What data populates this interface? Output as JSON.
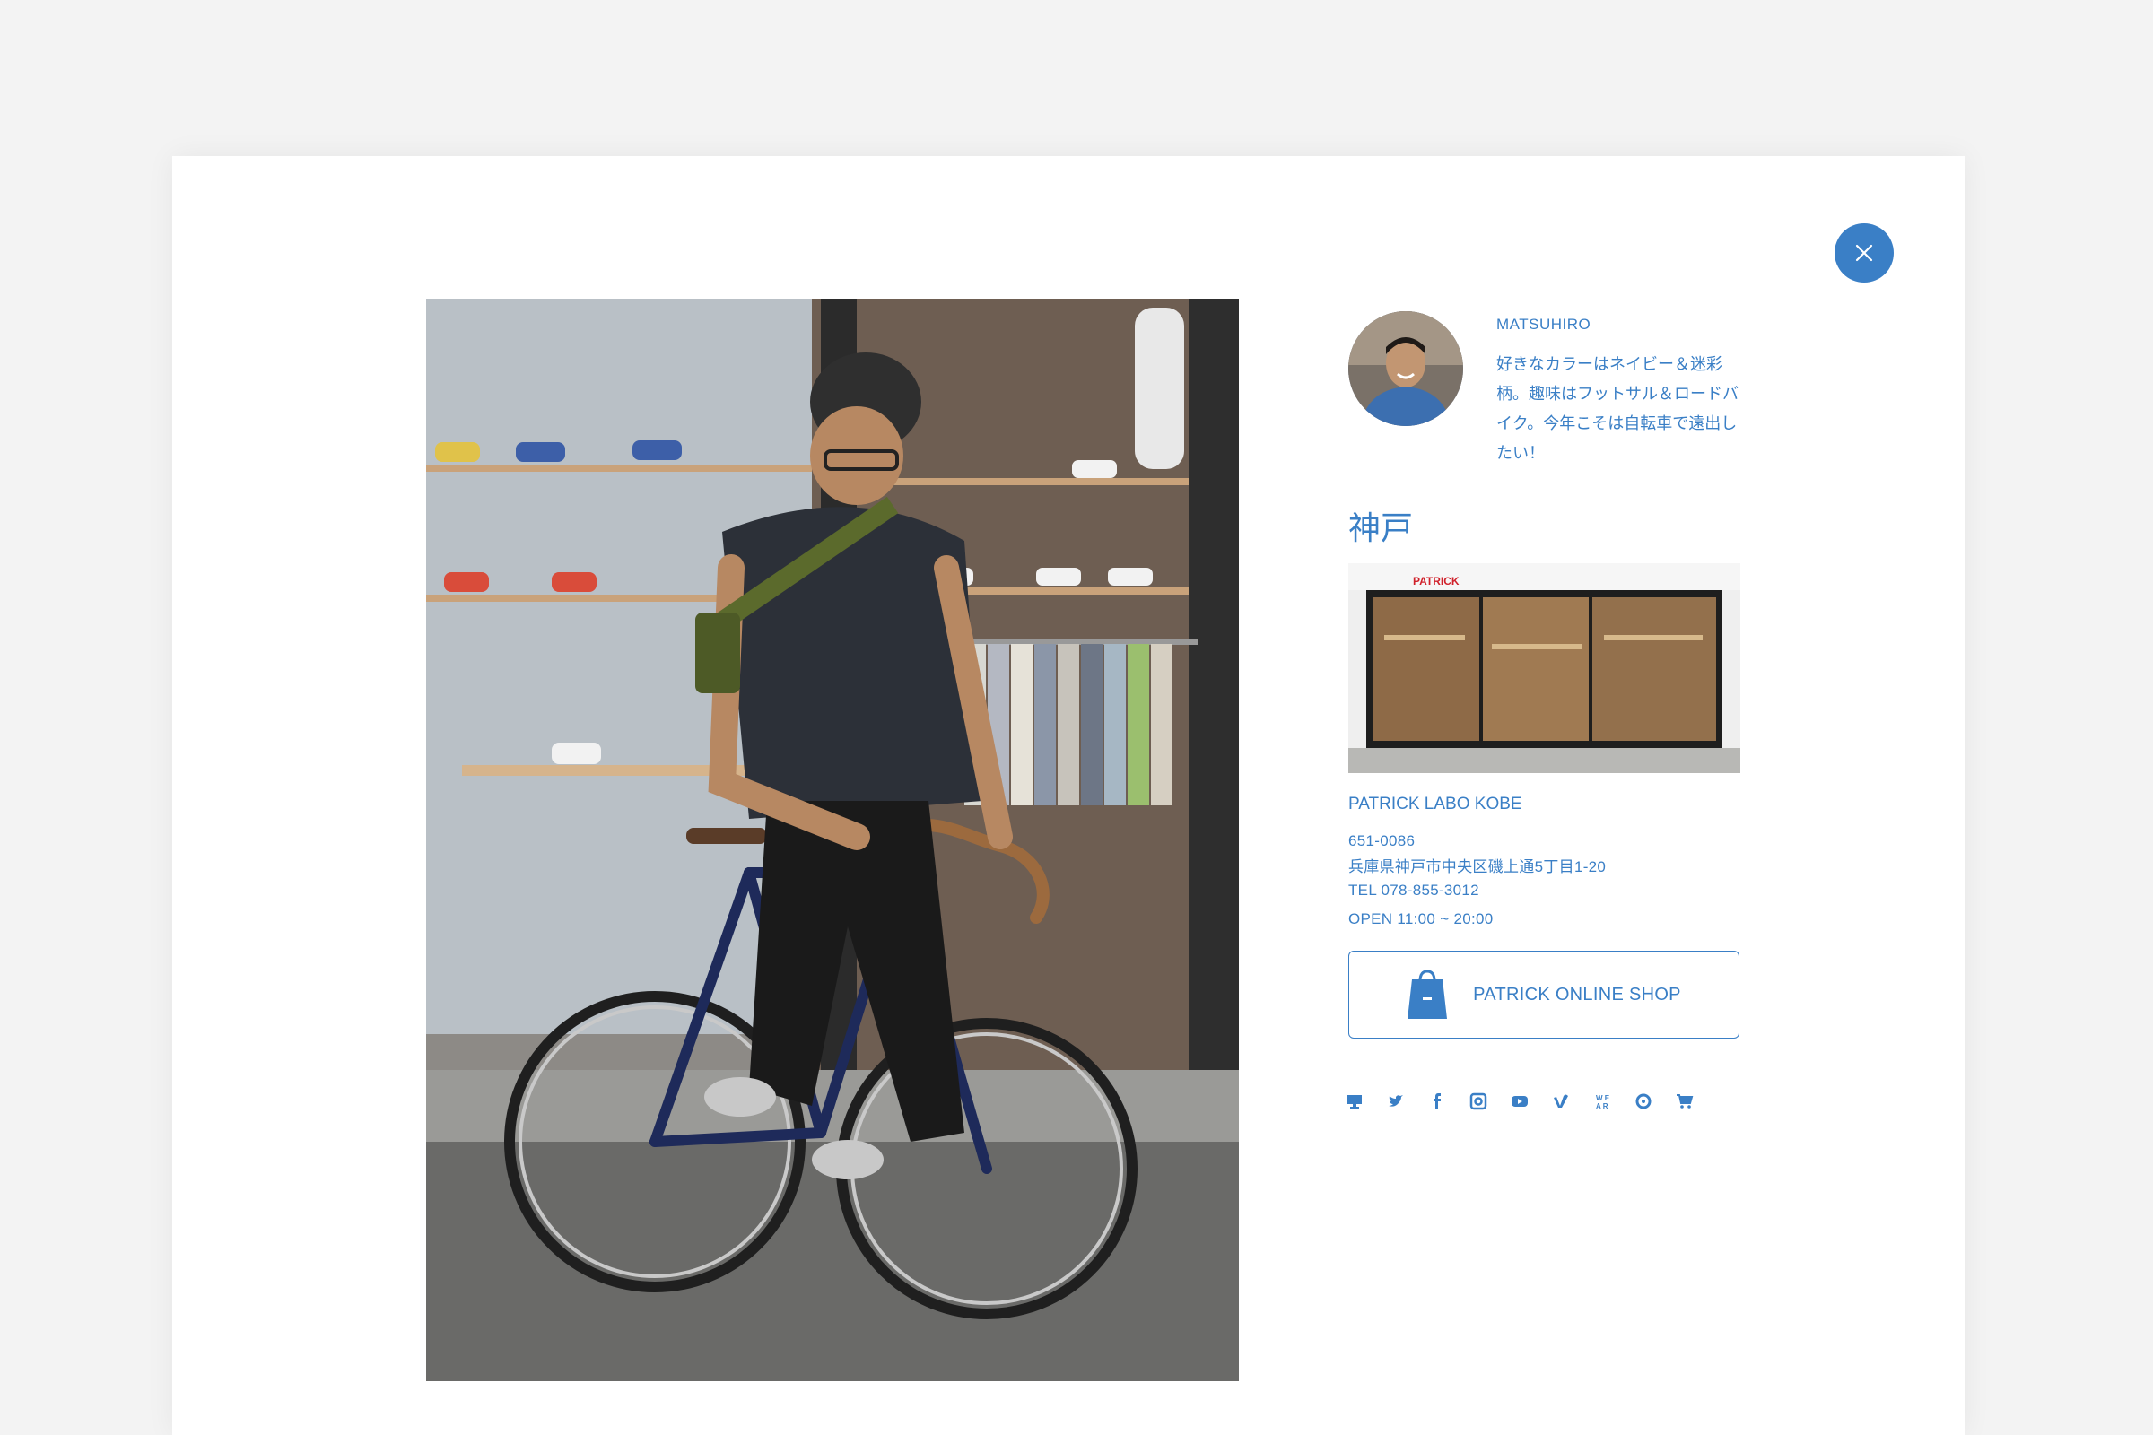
{
  "colors": {
    "accent": "#3a7fc6",
    "background": "#f3f3f3",
    "panel": "#ffffff"
  },
  "staff": {
    "name": "MATSUHIRO",
    "bio": "好きなカラーはネイビー＆迷彩柄。趣味はフットサル＆ロードバイク。今年こそは自転車で遠出したい！"
  },
  "store": {
    "city": "神戸",
    "name": "PATRICK LABO KOBE",
    "postal": "651-0086",
    "address": "兵庫県神戸市中央区磯上通5丁目1-20",
    "tel": "TEL 078-855-3012",
    "hours": "OPEN 11:00 ~ 20:00",
    "sign": "PATRICK"
  },
  "shop_button": {
    "label": "PATRICK ONLINE SHOP",
    "icon": "shopping-bag-icon"
  },
  "social_icons": [
    "website-icon",
    "twitter-icon",
    "facebook-icon",
    "instagram-icon",
    "youtube-icon",
    "vimeo-icon",
    "wear-icon",
    "shop-s-icon",
    "cart-icon"
  ],
  "close_icon": "close-icon"
}
